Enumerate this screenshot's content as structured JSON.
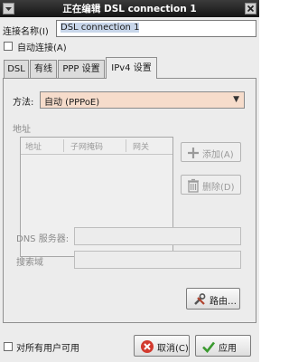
{
  "window": {
    "title": "正在编辑 DSL connection 1"
  },
  "connection": {
    "name_label": "连接名称(I)",
    "name_value": "DSL connection 1",
    "auto_connect_label": "自动连接(A)",
    "auto_connect_checked": false
  },
  "tabs": [
    {
      "label": "DSL",
      "active": false
    },
    {
      "label": "有线",
      "active": false
    },
    {
      "label": "PPP 设置",
      "active": false
    },
    {
      "label": "IPv4 设置",
      "active": true
    }
  ],
  "ipv4": {
    "method_label": "方法:",
    "method_value": "自动 (PPPoE)",
    "address_label": "地址",
    "address_columns": [
      "地址",
      "子网掩码",
      "网关"
    ],
    "add_button": "添加(A)",
    "delete_button": "删除(D)",
    "dns_label": "DNS 服务器:",
    "search_domains_label": "搜索域",
    "routes_button": "路由…"
  },
  "footer": {
    "all_users_label": "对所有用户可用",
    "all_users_checked": false,
    "cancel_button": "取消(C)",
    "apply_button": "应用"
  },
  "colors": {
    "titlebar": "#1f1f1f",
    "method_combo_bg": "#f6dccb",
    "window_bg": "#ececec"
  }
}
